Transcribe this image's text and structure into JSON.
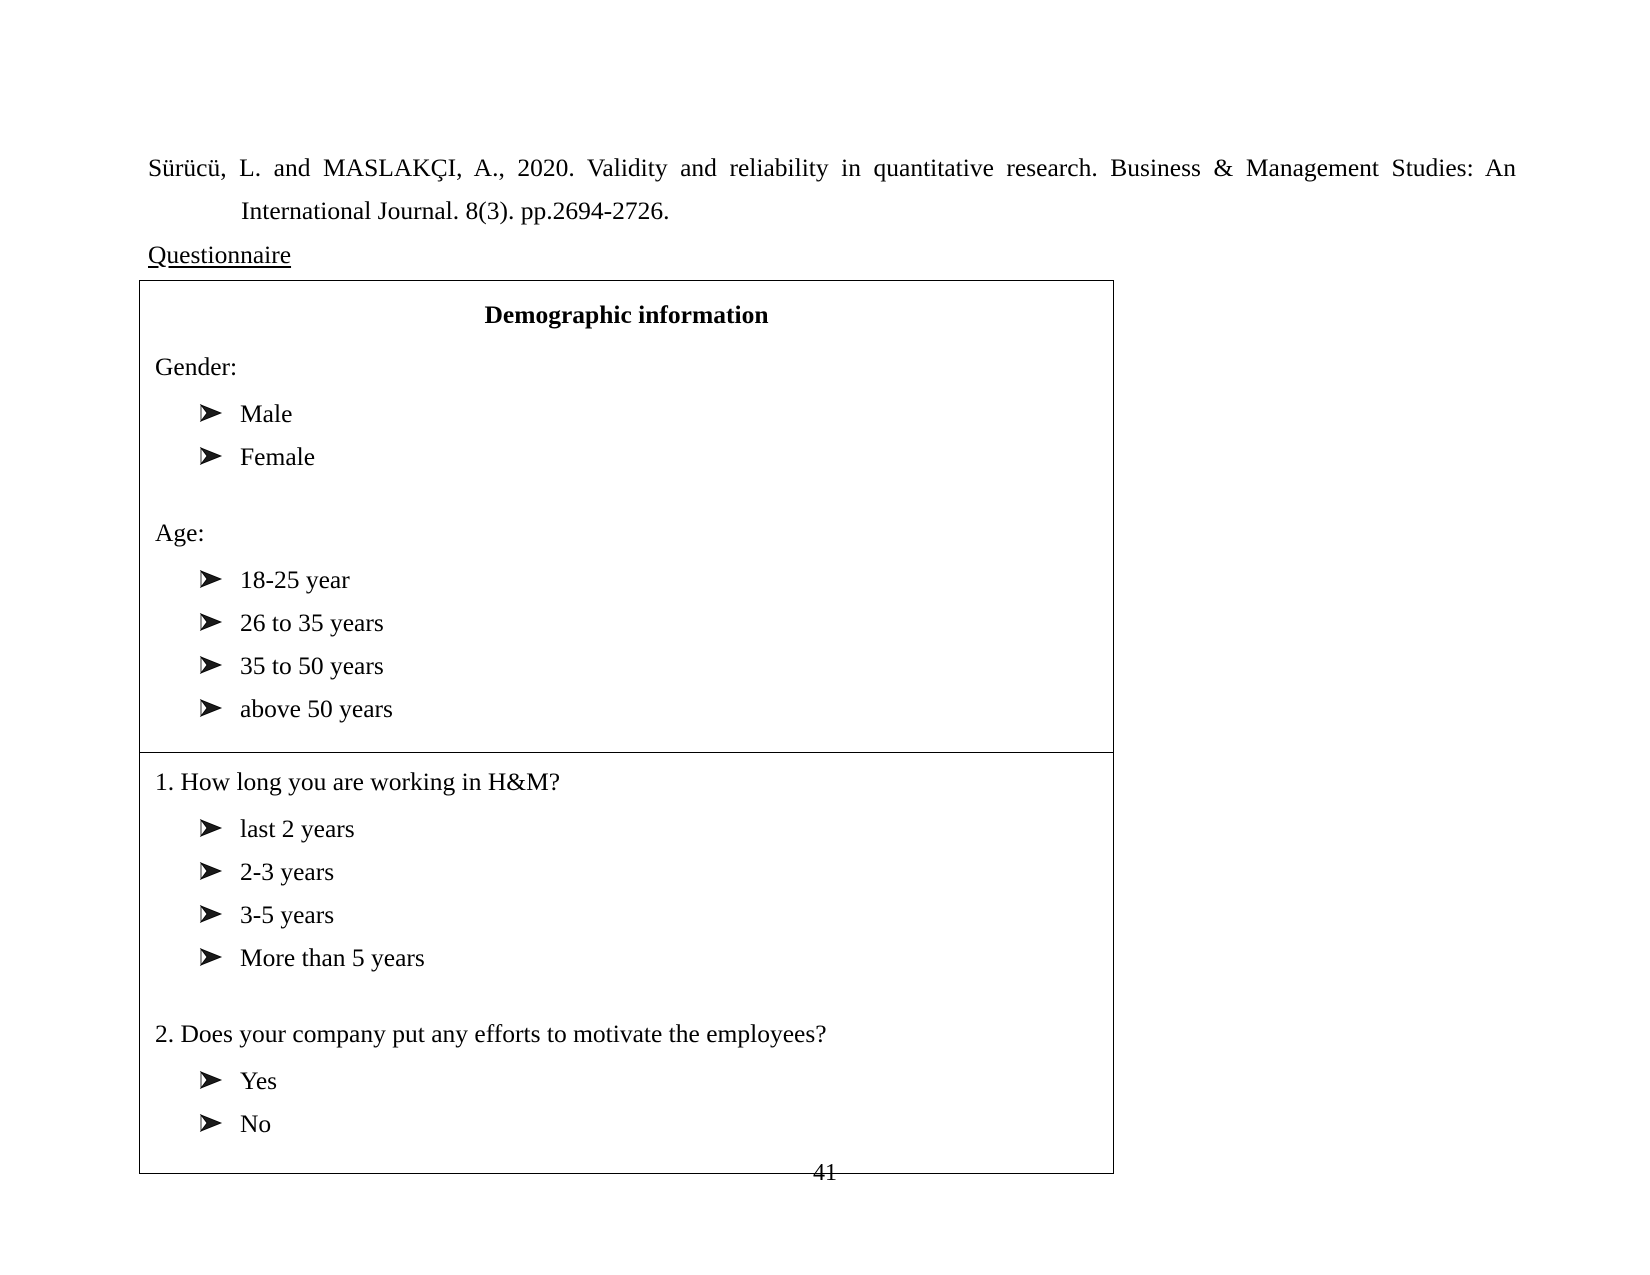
{
  "reference": {
    "line1": "Sürücü, L. and MASLAKÇI, A., 2020. Validity and reliability in quantitative research. Business & Management Studies: An",
    "line2": "International Journal. 8(3). pp.2694-2726."
  },
  "questionnaire_heading": "Questionnaire",
  "table": {
    "title": "Demographic information",
    "demographic": {
      "gender": {
        "prompt": "Gender:",
        "options": [
          "Male",
          "Female"
        ]
      },
      "age": {
        "prompt": "Age:",
        "options": [
          "18-25 year",
          "26 to 35 years",
          "35 to 50 years",
          "above 50 years"
        ]
      }
    },
    "questions": [
      {
        "prompt": "1. How long you are working in H&M?",
        "options": [
          "last 2 years",
          "2-3 years",
          "3-5 years",
          "More than 5 years"
        ]
      },
      {
        "prompt": "2. Does your company put any efforts to motivate the employees?",
        "options": [
          "Yes",
          "No"
        ]
      }
    ]
  },
  "bullet_icon": "arrow-bullet-icon",
  "page_number": "41",
  "colors": {
    "text": "#000000",
    "border": "#000000",
    "background": "#ffffff"
  }
}
